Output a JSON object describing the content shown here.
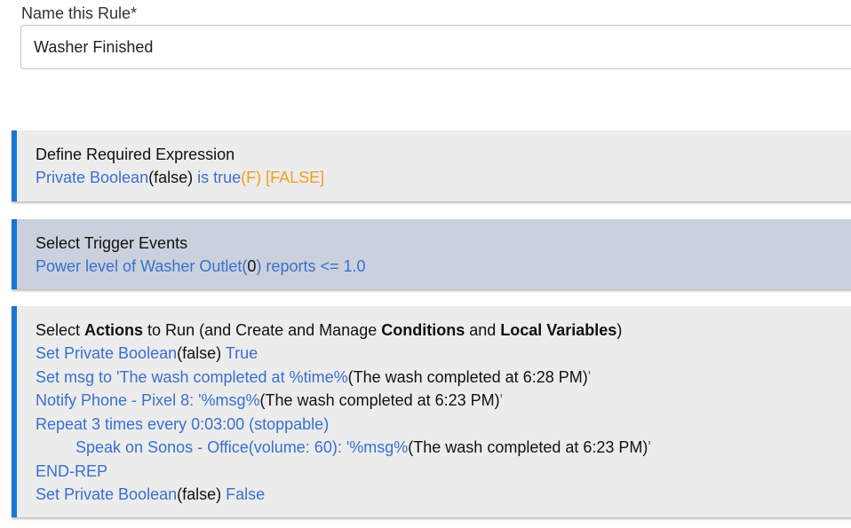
{
  "rule_name": {
    "label": "Name this Rule*",
    "value": "Washer Finished"
  },
  "required_expression": {
    "title": "Define Required Expression",
    "expr": {
      "subject": "Private Boolean",
      "subject_arg": "(false)",
      "condition": " is true",
      "current_state": "(F)",
      "result": " [FALSE]"
    }
  },
  "trigger_events": {
    "title": "Select Trigger Events",
    "event": {
      "device": "Power level of Washer Outlet(",
      "value": "0",
      "condition": ") reports <= 1.0"
    }
  },
  "actions": {
    "title": {
      "part1": "Select ",
      "bold1": "Actions",
      "part2": " to Run (and Create and Manage ",
      "bold2": "Conditions",
      "part3": " and ",
      "bold3": "Local Variables",
      "part4": ")"
    },
    "items": [
      {
        "blue": "Set Private Boolean",
        "black": "(false)",
        "blue2": " True"
      },
      {
        "blue": "Set msg to 'The wash completed at %time%",
        "black": "(The wash completed at 6:28 PM)",
        "blue2": "'"
      },
      {
        "blue": "Notify Phone - Pixel 8: '%msg%",
        "black": "(The wash completed at 6:23 PM)",
        "blue2": "'"
      },
      {
        "blue": "Repeat 3 times every 0:03:00 (stoppable)"
      },
      {
        "blue": "Speak on Sonos - Office(volume: 60): '%msg%",
        "black": "(The wash completed at 6:23 PM)",
        "blue2": "'"
      },
      {
        "blue": "END-REP"
      },
      {
        "blue": "Set Private Boolean",
        "black": "(false)",
        "blue2": " False"
      }
    ]
  },
  "colors": {
    "accent": "#1976d2",
    "link_blue": "#3a6fd0",
    "state_orange": "#f0a020",
    "card_gray": "#ececec",
    "trigger_card": "#cbd1dc"
  }
}
